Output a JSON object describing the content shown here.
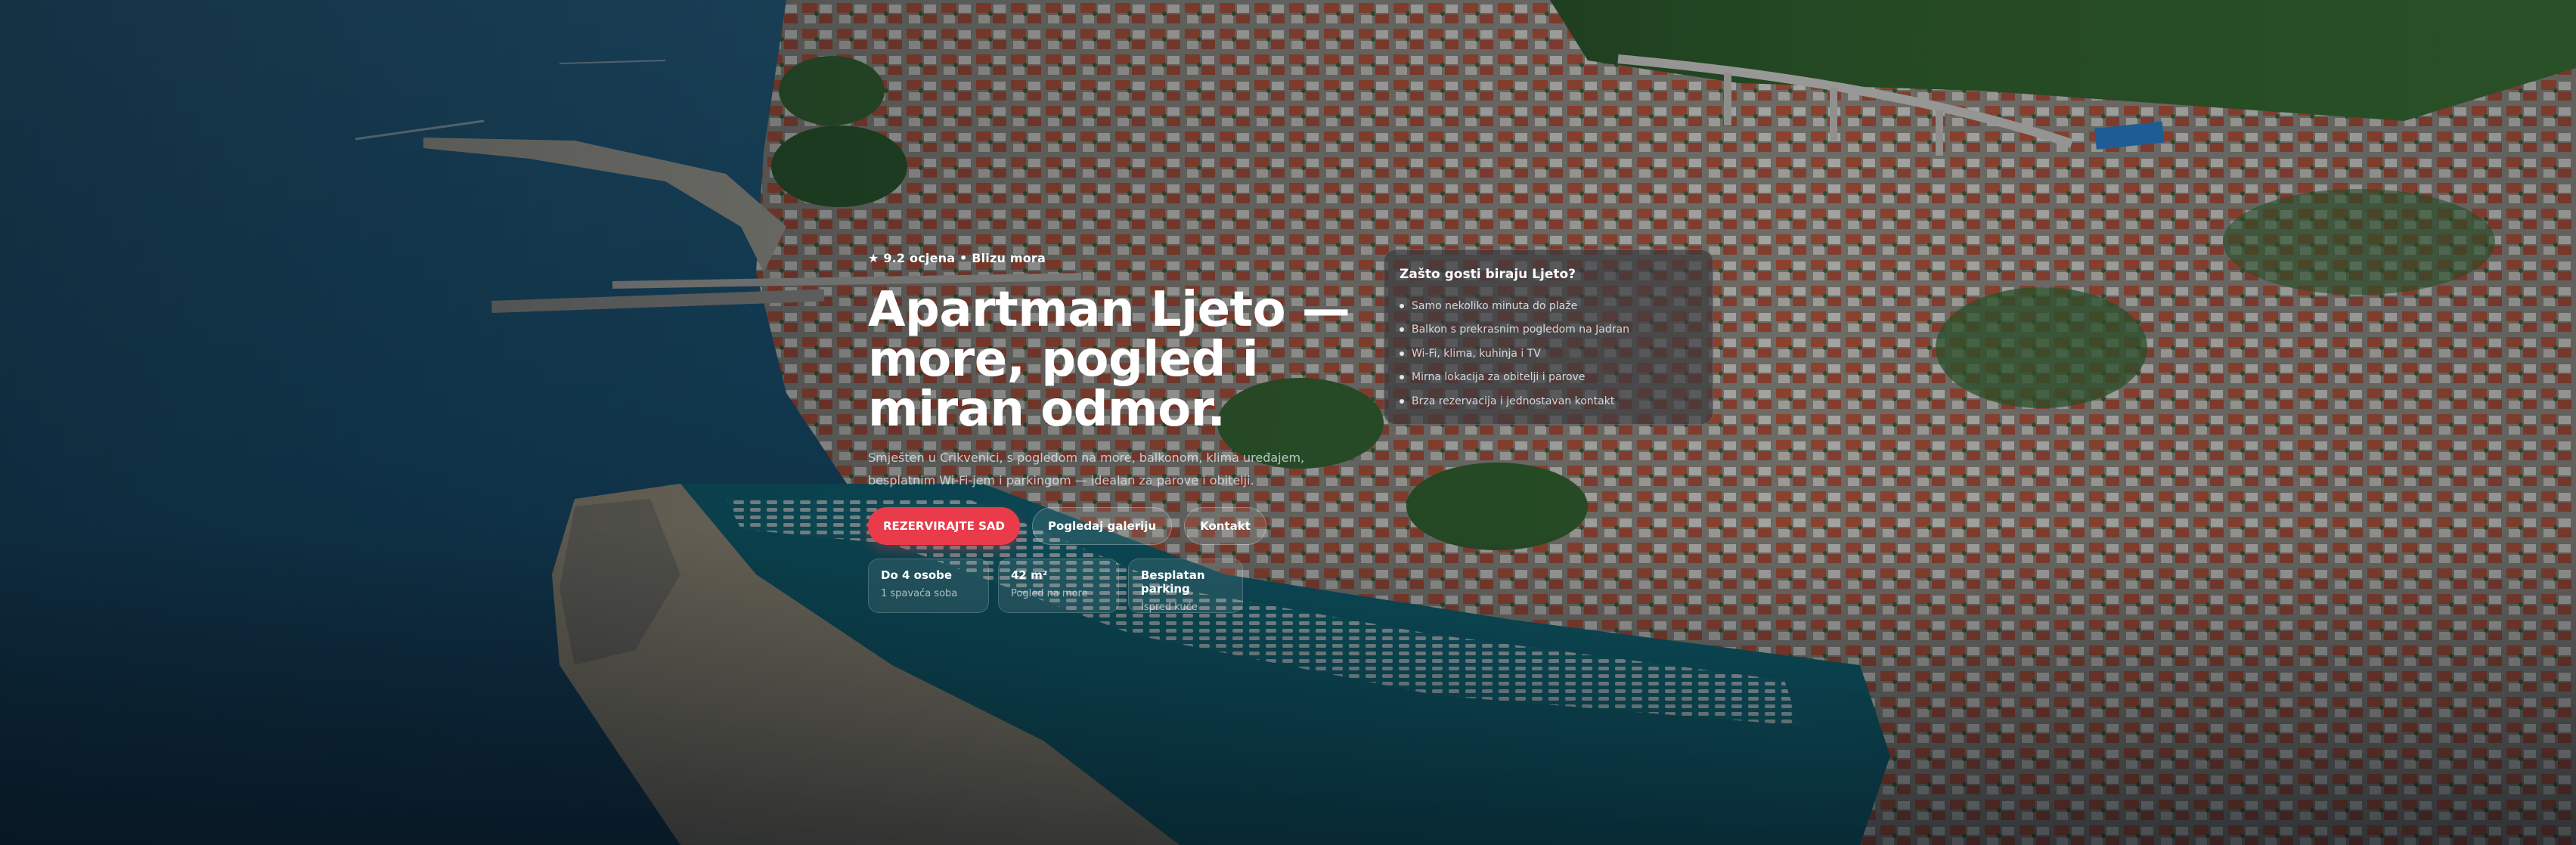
{
  "hero": {
    "rating": "★ 9.2 ocjena • Blizu mora",
    "title": "Apartman Ljeto — more, pogled i miran odmor.",
    "subtitle": "Smješten u Crikvenici, s pogledom na more, balkonom, klima uređajem, besplatnim Wi-Fi-jem i parkingom — idealan za parove i obitelji.",
    "buttons": {
      "reserve": "REZERVIRAJTE SAD",
      "gallery": "Pogledaj galeriju",
      "contact": "Kontakt"
    },
    "stats": [
      {
        "label": "Do 4 osobe",
        "sub": "1 spavaća soba"
      },
      {
        "label": "42 m²",
        "sub": "Pogled na more"
      },
      {
        "label": "Besplatan parking",
        "sub": "Ispred kuće"
      }
    ]
  },
  "card": {
    "title": "Zašto gosti biraju Ljeto?",
    "items": [
      "Samo nekoliko minuta do plaže",
      "Balkon s prekrasnim pogledom na Jadran",
      "Wi-Fi, klima, kuhinja i TV",
      "Mirna lokacija za obitelji i parove",
      "Brza rezervacija i jednostavan kontakt"
    ]
  },
  "colors": {
    "accent": "#ea3b4a",
    "sea_deep": "#0f4a66",
    "sea_lagoon": "#0f7c8c",
    "roof": "#c65a3a",
    "forest": "#2e5a2a"
  }
}
